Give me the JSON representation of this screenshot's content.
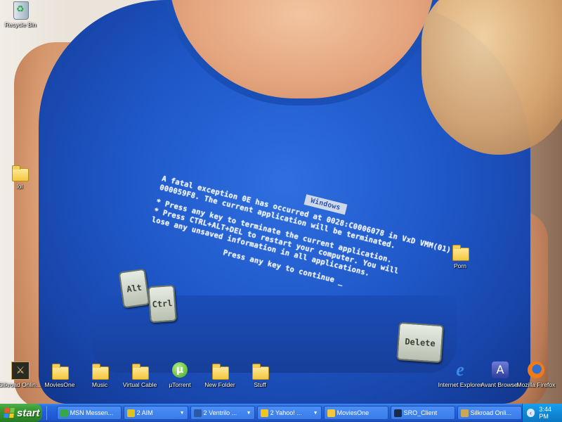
{
  "wallpaper": {
    "bsod": {
      "badge": "Windows",
      "line1": "A fatal exception 0E has occurred at 0028:C0006078 in VxD VMM(01) +",
      "line2": "000059F8. The current application will be terminated.",
      "line3": "* Press any key to terminate the current application.",
      "line4": "* Press CTRL+ALT+DEL to restart your computer. You will",
      "line5": "  lose any unsaved information in all applications.",
      "line6": "Press any key to continue _"
    },
    "keys": {
      "alt": "Alt",
      "ctrl": "Ctrl",
      "delete": "Delete"
    }
  },
  "desktop": {
    "icons": {
      "recycle_bin": "Recycle Bin",
      "lol": "lol",
      "porn": "Porn",
      "silkroad": "Silkroad Onlin...",
      "moviesone": "MoviesOne",
      "music": "Music",
      "virtual_cable": "Virtual Cable",
      "utorrent": "µTorrent",
      "new_folder": "New Folder",
      "stuff": "Stuff",
      "internet_explorer": "Internet Explorer",
      "avant_browser": "Avant Browser",
      "firefox": "Mozilla Firefox"
    }
  },
  "taskbar": {
    "start_label": "start",
    "tasks": [
      {
        "label": "MSN Messen...",
        "color": "#36a84a",
        "has_caret": false
      },
      {
        "label": "2 AIM",
        "color": "#e0c21a",
        "has_caret": true
      },
      {
        "label": "2 Ventrilo ...",
        "color": "#2b5aa8",
        "has_caret": true
      },
      {
        "label": "2 Yahoo! ...",
        "color": "#f2c41c",
        "has_caret": true
      },
      {
        "label": "MoviesOne",
        "color": "#f3c83e",
        "has_caret": false
      },
      {
        "label": "SRO_Client",
        "color": "#1a2a4a",
        "has_caret": false
      },
      {
        "label": "Silkroad Onli...",
        "color": "#c9a85a",
        "has_caret": false
      }
    ],
    "clock": "3:44 PM"
  },
  "colors": {
    "taskbar": "#245edb",
    "start_green": "#3b9a36",
    "tray": "#0f8ad8",
    "shirt_blue": "#1f58c9"
  }
}
